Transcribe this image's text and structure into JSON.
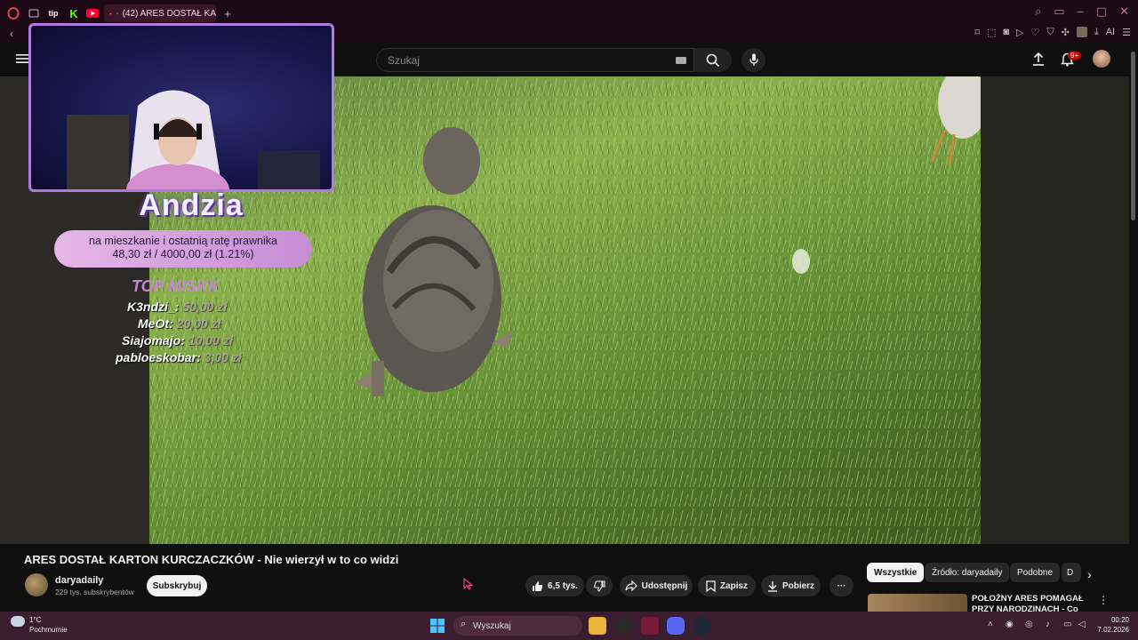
{
  "browser": {
    "tab_title": "(42) ARES DOSTAŁ KA",
    "tab_prefix_icons": [
      "opera-icon",
      "tab-icon",
      "tip-icon",
      "kick-icon",
      "youtube-icon"
    ],
    "tip_label": "tip",
    "kick_label": "K",
    "new_tab_label": "+",
    "ai_label": "AI"
  },
  "youtube": {
    "search_placeholder": "Szukaj",
    "notifications_badge": "9+"
  },
  "overlay": {
    "streamer_name": "Andzia",
    "goal_text": "na mieszkanie i ostatnią ratę prawnika",
    "goal_progress": "48,30 zł  /  4000,00 zł  (1.21%)",
    "goal_fraction": 0.0121,
    "top_title": "TOP MISKK",
    "donors": [
      {
        "name": "K3ndzi_:",
        "amount": "50,00 zł"
      },
      {
        "name": "MeOt:",
        "amount": "20,00 zł"
      },
      {
        "name": "Siajomajo:",
        "amount": "10,00 zł"
      },
      {
        "name": "pabloeskobar:",
        "amount": "3,00 zł"
      }
    ]
  },
  "video": {
    "title": "ARES DOSTAŁ KARTON KURCZACZKÓW - Nie wierzył w to co widzi",
    "channel": "daryadaily",
    "subscribers": "229 tys. subskrybentów",
    "subscribe_label": "Subskrybuj",
    "likes": "6,5 tys.",
    "share_label": "Udostępnij",
    "save_label": "Zapisz",
    "download_label": "Pobierz",
    "more_label": "···"
  },
  "sidebar": {
    "chips": [
      "Wszystkie",
      "Źródło: daryadaily",
      "Podobne",
      "D"
    ],
    "recommended_title": "POŁOŻNY ARES POMAGAŁ PRZY NARODZINACH - Co on"
  },
  "taskbar": {
    "weather_temp": "1°C",
    "weather_desc": "Pochmurnie",
    "search_label": "Wyszukaj",
    "time": "00:20",
    "date": "7.02.2026"
  },
  "colors": {
    "browser_frame": "#1b0a14",
    "accent_pink": "#d46e9a",
    "overlay_purple": "#b07be0",
    "taskbar": "#3a1d2e"
  }
}
